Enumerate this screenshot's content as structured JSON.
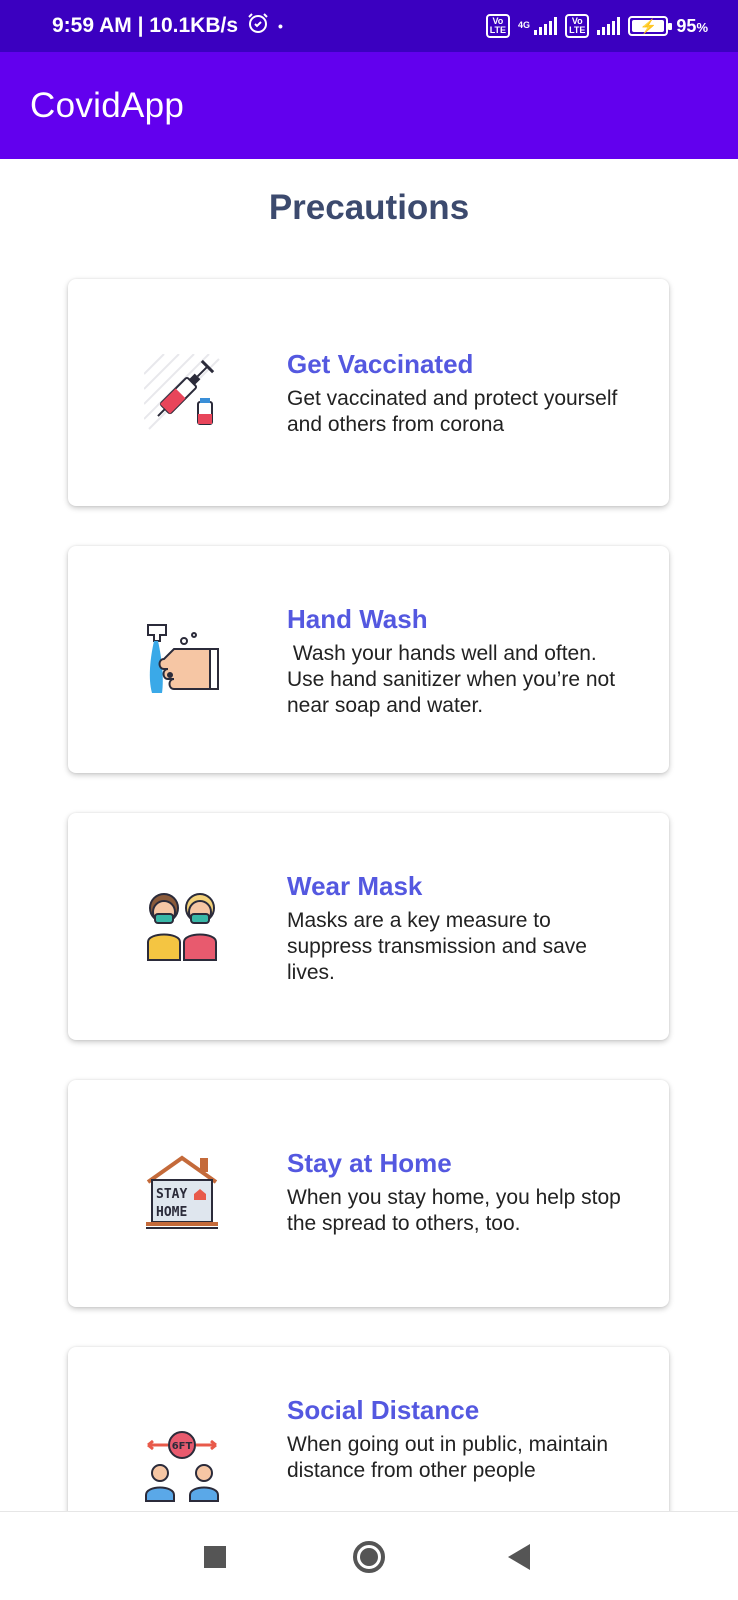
{
  "status_bar": {
    "time_speed": "9:59 AM | 10.1KB/s",
    "alarm_icon": "alarm-icon",
    "lte_badge": "Vo\nLTE",
    "network_type": "4G",
    "battery_percent": "95",
    "battery_unit": "%",
    "battery_level": 0.95
  },
  "app_bar": {
    "title": "CovidApp"
  },
  "page": {
    "title": "Precautions"
  },
  "cards": [
    {
      "icon": "syringe-icon",
      "title": "Get Vaccinated",
      "description": "Get vaccinated and protect yourself and others from corona"
    },
    {
      "icon": "hand-wash-icon",
      "title": "Hand Wash",
      "description": " Wash your hands well and often. Use hand sanitizer when you’re not near soap and water."
    },
    {
      "icon": "mask-people-icon",
      "title": "Wear Mask",
      "description": "Masks are a key measure to suppress transmission and save lives."
    },
    {
      "icon": "stay-home-icon",
      "title": "Stay at Home",
      "description": "When you stay home, you help stop the spread to others, too."
    },
    {
      "icon": "social-distance-icon",
      "title": "Social Distance",
      "description": "When going out in public, maintain distance from other people"
    }
  ],
  "stay_home_icon_text": [
    "STAY",
    "HOME"
  ],
  "social_distance_icon_text": "6FT",
  "nav_bar": {
    "recents": "recents-button",
    "home": "home-button",
    "back": "back-button"
  }
}
